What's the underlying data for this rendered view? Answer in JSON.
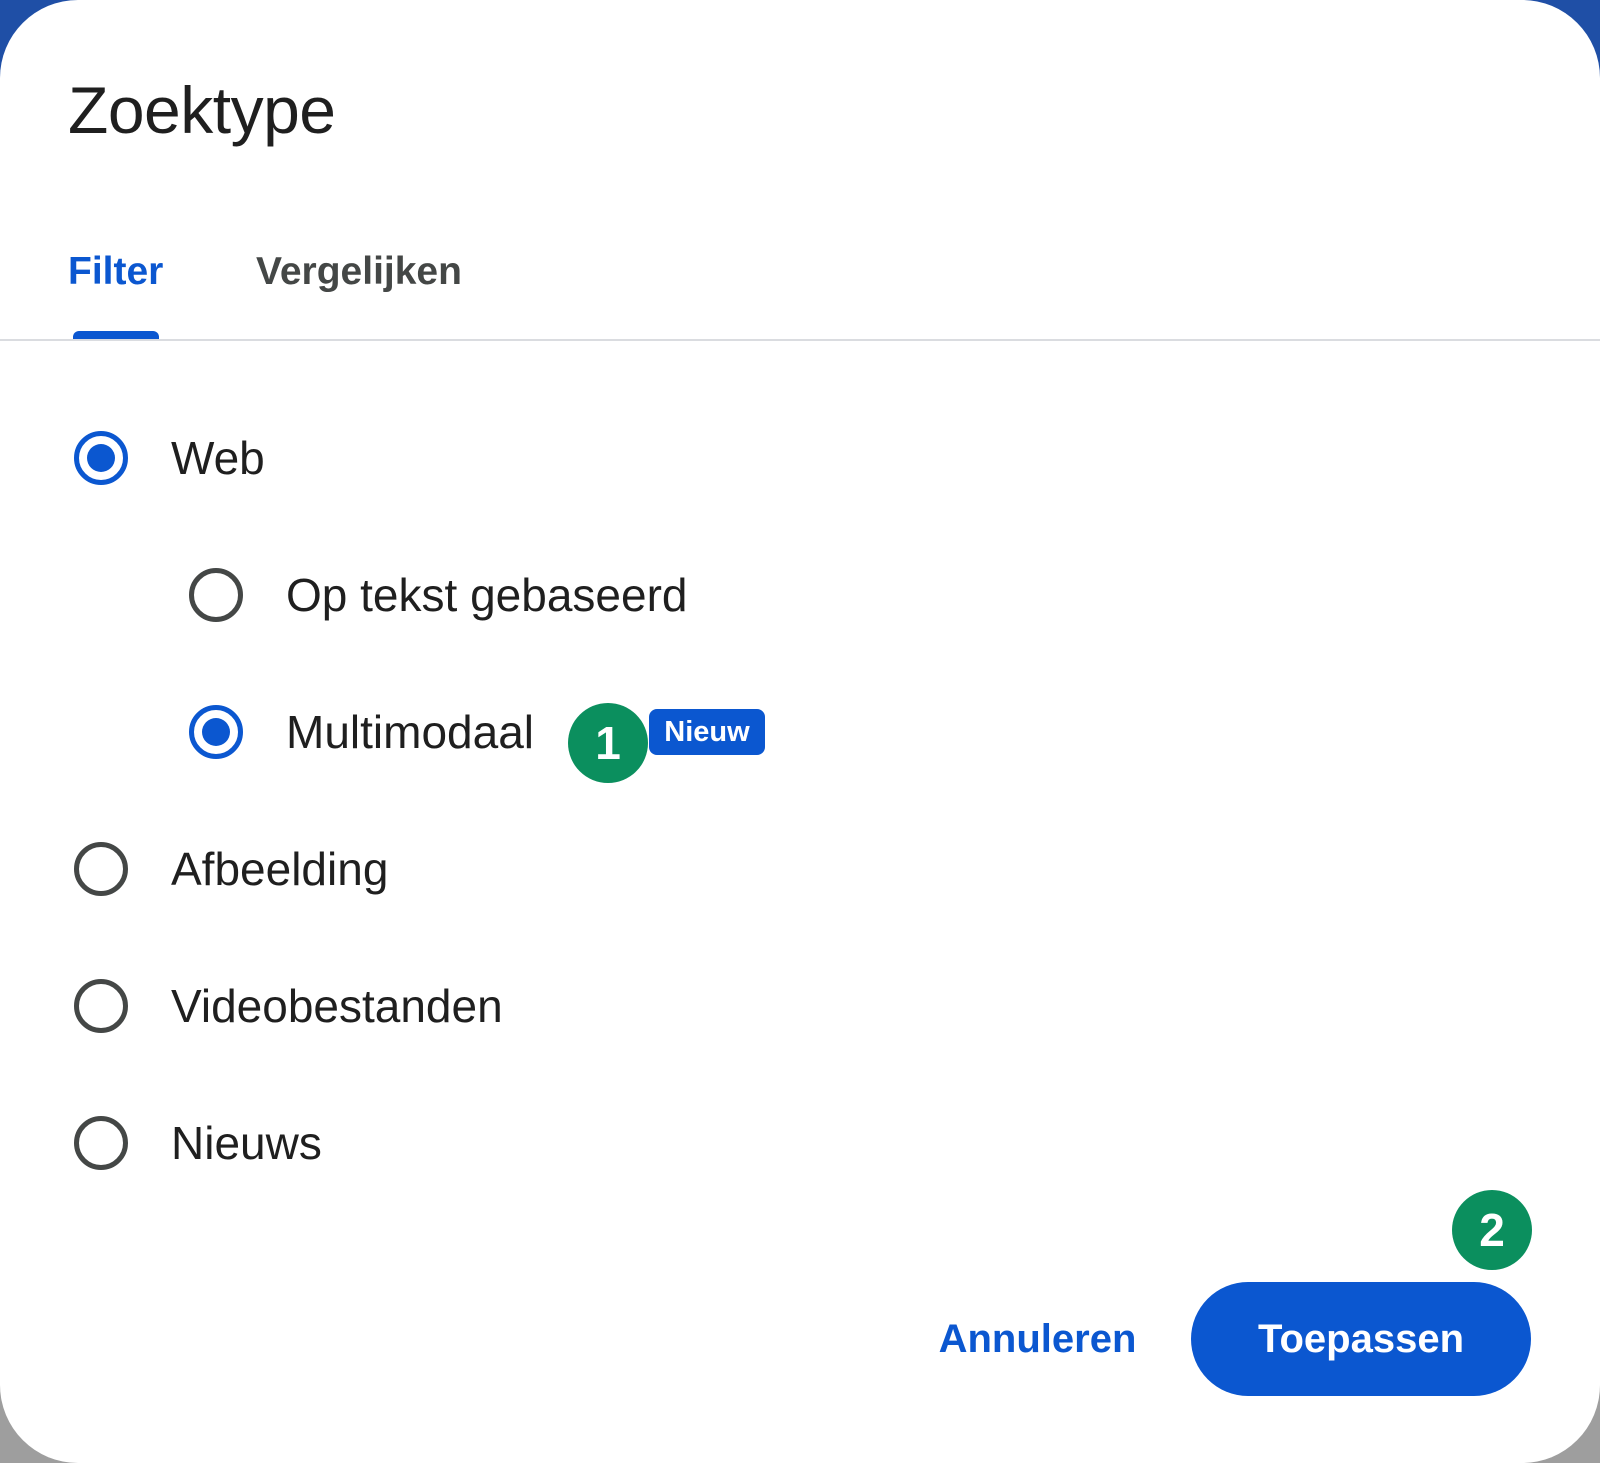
{
  "dialog": {
    "title": "Zoektype"
  },
  "tabs": [
    {
      "label": "Filter",
      "selected": true
    },
    {
      "label": "Vergelijken",
      "selected": false
    }
  ],
  "options": [
    {
      "label": "Web",
      "checked": true
    },
    {
      "label": "Op tekst gebaseerd",
      "checked": false
    },
    {
      "label": "Multimodaal",
      "checked": true,
      "badge": "Nieuw"
    },
    {
      "label": "Afbeelding",
      "checked": false
    },
    {
      "label": "Videobestanden",
      "checked": false
    },
    {
      "label": "Nieuws",
      "checked": false
    }
  ],
  "markers": [
    "1",
    "2"
  ],
  "actions": {
    "cancel_label": "Annuleren",
    "apply_label": "Toepassen"
  },
  "colors": {
    "accent": "#0b57d0",
    "marker": "#0b8f5e",
    "text": "#1f1f1f",
    "backdrop": "#1f4fa6"
  },
  "icons": [
    "radio-checked-icon",
    "radio-unchecked-icon"
  ]
}
